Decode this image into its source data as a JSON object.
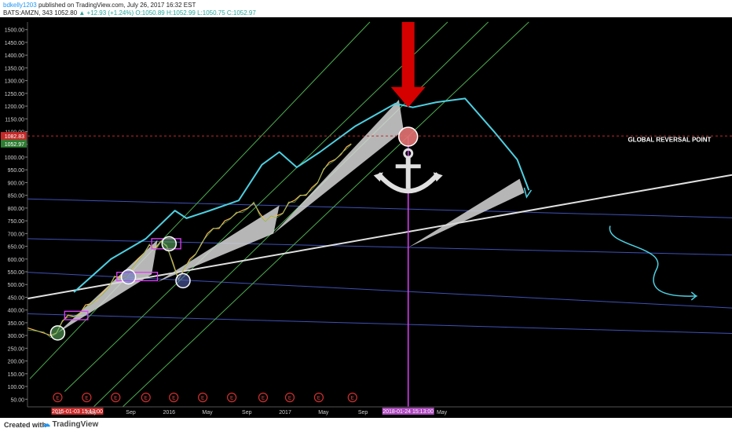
{
  "header": {
    "user": "bdkelly1203",
    "published": "published on TradingView.com, July 26, 2017 16:32 EST",
    "symbol_line_prefix": "BATS:AMZN, 343",
    "last_price": "1052.80",
    "change": "▲ +12.93 (+1.24%)",
    "ohlc": "O:1050.89 H:1052.99 L:1050.75 C:1052.97"
  },
  "footer": {
    "created_with": "Created with",
    "brand": "TradingView"
  },
  "colors": {
    "background": "#000000",
    "price_line_a": "#ffb74d",
    "price_line_b": "#66bb6a",
    "ma_line": "#e65100",
    "channel": "#4caf50",
    "horizontal_trend": "#3f51b5",
    "support_line": "#e0e0e0",
    "projection": "#4dd0e1",
    "marker": "#e040fb",
    "arrow": "#d50000",
    "global_label": "#ffffff",
    "price_tag_red": "#c62828",
    "price_tag_green": "#2e7d32"
  },
  "chart_data": {
    "type": "line",
    "title": "",
    "xlabel": "",
    "ylabel": "",
    "ylim": [
      20,
      1530
    ],
    "yticks": [
      50,
      100,
      150,
      200,
      250,
      300,
      350,
      400,
      450,
      500,
      550,
      600,
      650,
      700,
      750,
      800,
      850,
      900,
      950,
      1000,
      1050,
      1100,
      1150,
      1200,
      1250,
      1300,
      1350,
      1400,
      1450,
      1500
    ],
    "ytick_labels": [
      "50.00",
      "100.00",
      "150.00",
      "200.00",
      "250.00",
      "300.00",
      "350.00",
      "400.00",
      "450.00",
      "500.00",
      "550.00",
      "600.00",
      "650.00",
      "700.00",
      "750.00",
      "800.00",
      "850.00",
      "900.00",
      "950.00",
      "1000.00",
      "1050.00",
      "1100.00",
      "1150.00",
      "1200.00",
      "1250.00",
      "1300.00",
      "1350.00",
      "1400.00",
      "1450.00",
      "1500.00"
    ],
    "price_tags": [
      {
        "value": 1082.83,
        "label": "1082.83",
        "color": "#c62828"
      },
      {
        "value": 1052.97,
        "label": "1052.97",
        "color": "#2e7d32"
      }
    ],
    "xticks": [
      {
        "t": 2015.0,
        "label": "2015-01-03 15:13:00",
        "highlight": "#c62828"
      },
      {
        "t": 2015.05,
        "label": "15"
      },
      {
        "t": 2015.33,
        "label": "May"
      },
      {
        "t": 2015.67,
        "label": "Sep"
      },
      {
        "t": 2016.0,
        "label": "2016"
      },
      {
        "t": 2016.33,
        "label": "May"
      },
      {
        "t": 2016.67,
        "label": "Sep"
      },
      {
        "t": 2017.0,
        "label": "2017"
      },
      {
        "t": 2017.33,
        "label": "May"
      },
      {
        "t": 2017.67,
        "label": "Sep"
      },
      {
        "t": 2018.06,
        "label": "2018-01-24 15:13:00",
        "highlight": "#ab47bc"
      },
      {
        "t": 2018.35,
        "label": "May"
      }
    ],
    "xrange": [
      2014.78,
      2020.85
    ],
    "earnings_markers": [
      2015.04,
      2015.29,
      2015.54,
      2015.8,
      2016.04,
      2016.29,
      2016.54,
      2016.81,
      2017.04,
      2017.29,
      2017.58
    ],
    "earnings_label": "E",
    "series": [
      {
        "x": [
          2014.78,
          2014.85,
          2014.92,
          2014.98,
          2015.03,
          2015.08,
          2015.13,
          2015.18,
          2015.23,
          2015.28,
          2015.33,
          2015.38,
          2015.43,
          2015.48,
          2015.53,
          2015.58,
          2015.63,
          2015.68,
          2015.73,
          2015.78,
          2015.83,
          2015.88,
          2015.93,
          2015.98,
          2016.03,
          2016.08,
          2016.13,
          2016.18,
          2016.23,
          2016.28,
          2016.33,
          2016.38,
          2016.43,
          2016.48,
          2016.53,
          2016.58,
          2016.63,
          2016.68,
          2016.73,
          2016.78,
          2016.83,
          2016.88,
          2016.93,
          2016.98,
          2017.03,
          2017.08,
          2017.13,
          2017.18,
          2017.23,
          2017.28,
          2017.33,
          2017.38,
          2017.43,
          2017.48,
          2017.53,
          2017.57
        ],
        "values": [
          330,
          320,
          310,
          300,
          310,
          355,
          380,
          375,
          385,
          420,
          425,
          440,
          470,
          490,
          530,
          530,
          530,
          560,
          600,
          620,
          655,
          640,
          670,
          650,
          590,
          520,
          560,
          600,
          620,
          660,
          700,
          720,
          720,
          750,
          760,
          780,
          790,
          800,
          820,
          780,
          750,
          765,
          770,
          780,
          820,
          830,
          850,
          850,
          880,
          900,
          950,
          980,
          990,
          1010,
          1040,
          1052
        ]
      }
    ],
    "annotations": [
      {
        "type": "label",
        "text": "GLOBAL REVERSAL POINT",
        "value": 1060
      }
    ]
  }
}
